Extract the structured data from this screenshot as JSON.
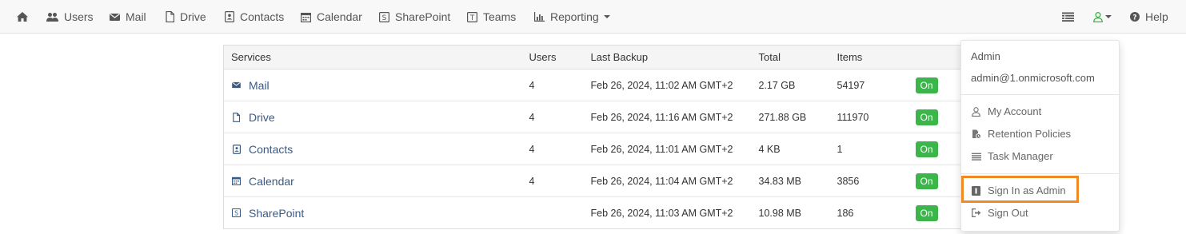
{
  "nav": {
    "home_icon": "home-icon",
    "users": "Users",
    "mail": "Mail",
    "drive": "Drive",
    "contacts": "Contacts",
    "calendar": "Calendar",
    "sharepoint": "SharePoint",
    "teams": "Teams",
    "reporting": "Reporting",
    "help": "Help"
  },
  "table": {
    "headers": [
      "Services",
      "Users",
      "Last Backup",
      "Total",
      "Items",
      ""
    ],
    "rows": [
      {
        "service": "Mail",
        "icon": "envelope-icon",
        "users": "4",
        "last_backup": "Feb 26, 2024, 11:02 AM GMT+2",
        "total": "2.17 GB",
        "items": "54197",
        "status": "On"
      },
      {
        "service": "Drive",
        "icon": "file-icon",
        "users": "4",
        "last_backup": "Feb 26, 2024, 11:16 AM GMT+2",
        "total": "271.88 GB",
        "items": "111970",
        "status": "On"
      },
      {
        "service": "Contacts",
        "icon": "contact-card-icon",
        "users": "4",
        "last_backup": "Feb 26, 2024, 11:01 AM GMT+2",
        "total": "4 KB",
        "items": "1",
        "status": "On"
      },
      {
        "service": "Calendar",
        "icon": "calendar-icon",
        "users": "4",
        "last_backup": "Feb 26, 2024, 11:04 AM GMT+2",
        "total": "34.83 MB",
        "items": "3856",
        "status": "On"
      },
      {
        "service": "SharePoint",
        "icon": "sharepoint-icon",
        "users": "",
        "last_backup": "Feb 26, 2024, 11:03 AM GMT+2",
        "total": "10.98 MB",
        "items": "186",
        "status": "On"
      }
    ]
  },
  "account_menu": {
    "name": "Admin",
    "email": "admin@1.onmicrosoft.com",
    "my_account": "My Account",
    "retention_policies": "Retention Policies",
    "task_manager": "Task Manager",
    "sign_in_as_admin": "Sign In as Admin",
    "sign_out": "Sign Out"
  },
  "colors": {
    "status_on": "#3cb54a",
    "highlight": "#f08a24",
    "user_icon": "#3cb54a",
    "link": "#3a5a86"
  }
}
